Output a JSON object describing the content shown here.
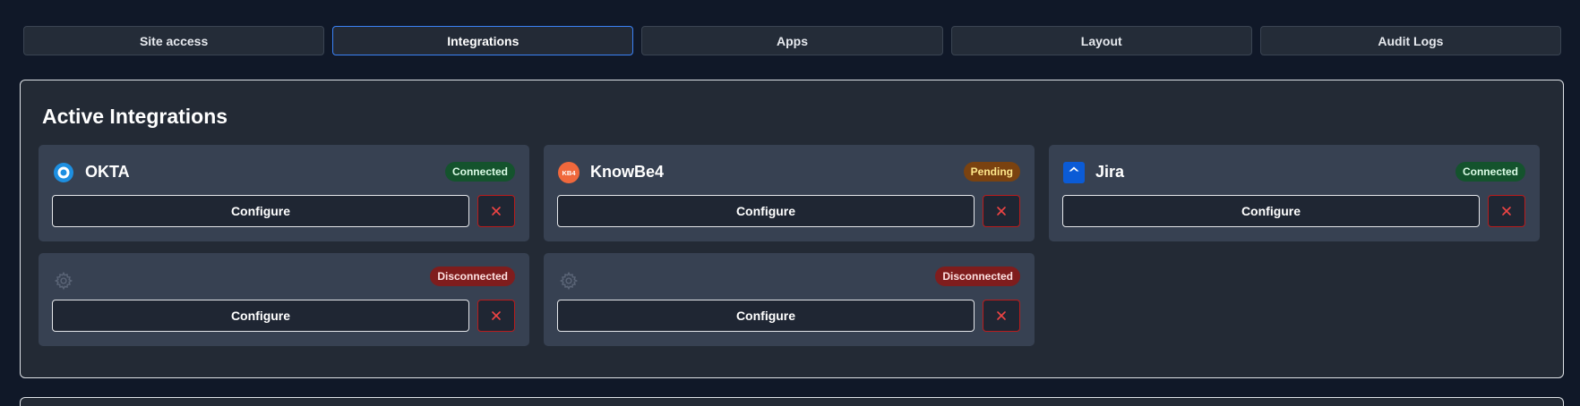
{
  "tabs": [
    {
      "label": "Site access",
      "active": false
    },
    {
      "label": "Integrations",
      "active": true
    },
    {
      "label": "Apps",
      "active": false
    },
    {
      "label": "Layout",
      "active": false
    },
    {
      "label": "Audit Logs",
      "active": false
    }
  ],
  "panel": {
    "title": "Active Integrations"
  },
  "integrations": [
    {
      "name": "OKTA",
      "icon": "okta-logo-icon",
      "status": "Connected",
      "configure_label": "Configure"
    },
    {
      "name": "KnowBe4",
      "icon": "knowbe4-logo-icon",
      "icon_text": "KB4",
      "status": "Pending",
      "configure_label": "Configure"
    },
    {
      "name": "Jira",
      "icon": "jira-logo-icon",
      "status": "Connected",
      "configure_label": "Configure"
    },
    {
      "name": "",
      "icon": "gear-icon",
      "status": "Disconnected",
      "configure_label": "Configure"
    },
    {
      "name": "",
      "icon": "gear-icon",
      "status": "Disconnected",
      "configure_label": "Configure"
    }
  ],
  "colors": {
    "background": "#101828",
    "card": "#374152",
    "active_tab_border": "#3b82f6",
    "connected": "#14532d",
    "pending": "#7a4210",
    "disconnected": "#7f1d1d"
  }
}
